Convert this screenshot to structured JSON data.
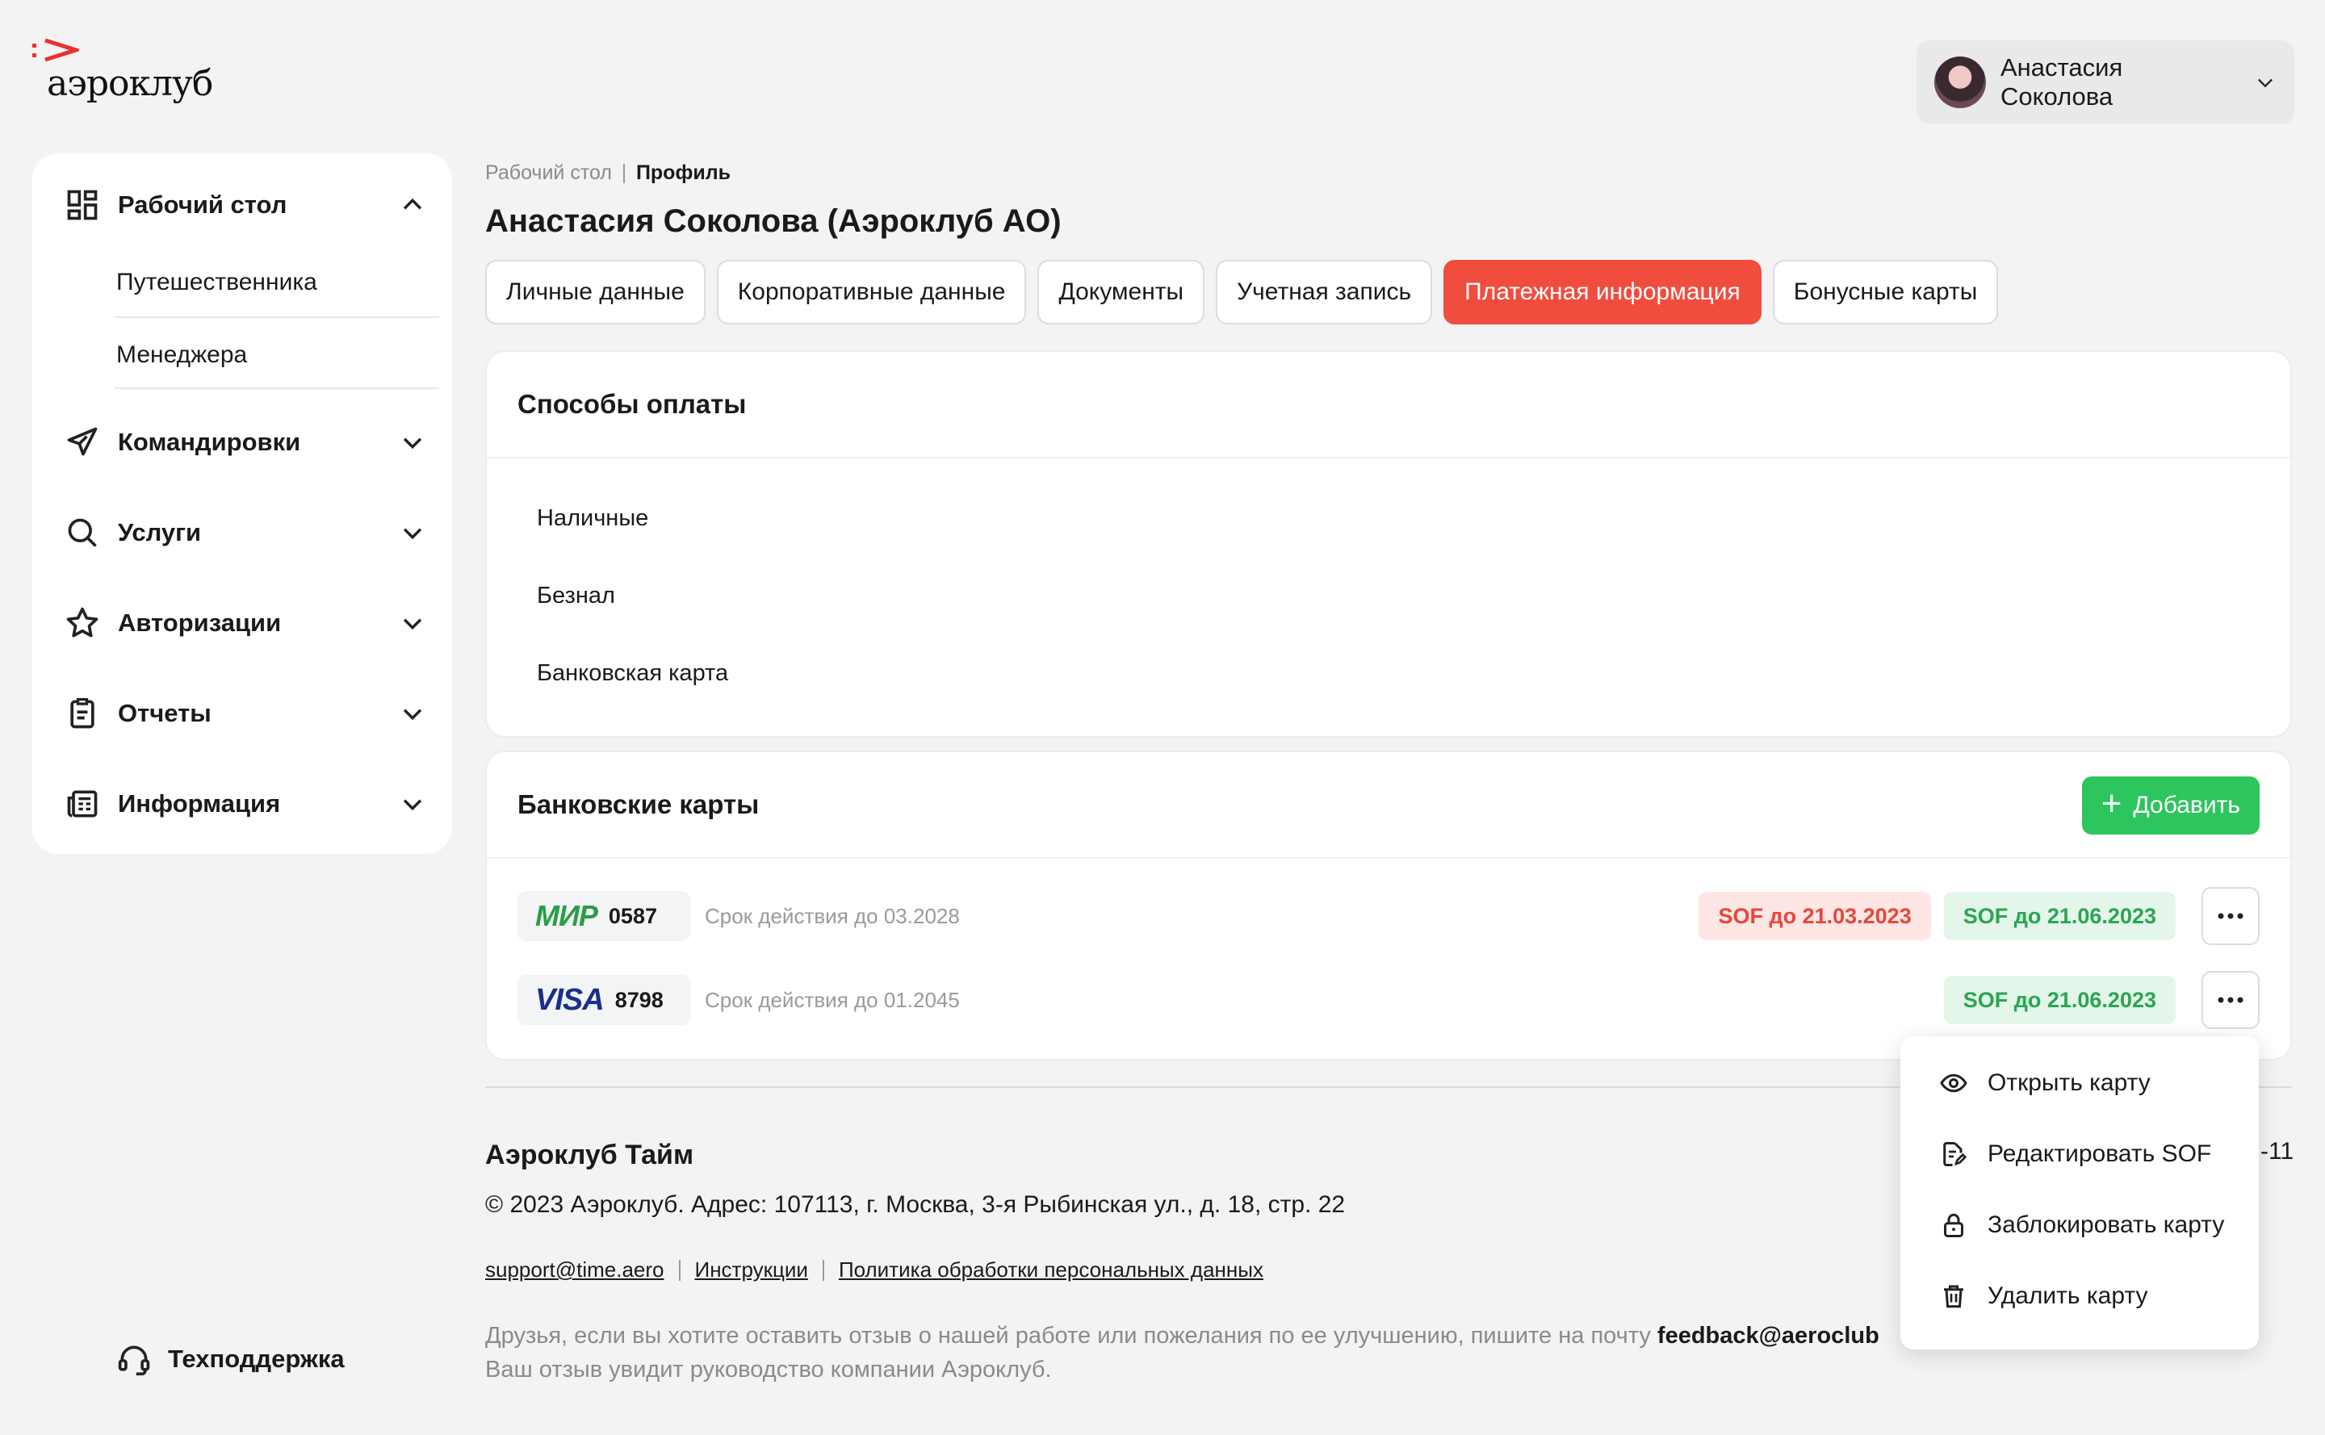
{
  "brand": {
    "name": "аэроклуб",
    "accent": "#e8322b"
  },
  "user": {
    "name": "Анастасия Соколова"
  },
  "sidebar": {
    "items": [
      {
        "label": "Рабочий стол",
        "icon": "dashboard-icon",
        "expanded": true,
        "children": [
          "Путешественника",
          "Менеджера"
        ]
      },
      {
        "label": "Командировки",
        "icon": "paper-plane-icon"
      },
      {
        "label": "Услуги",
        "icon": "search-icon"
      },
      {
        "label": "Авторизации",
        "icon": "star-icon"
      },
      {
        "label": "Отчеты",
        "icon": "clipboard-icon"
      },
      {
        "label": "Информация",
        "icon": "newspaper-icon"
      }
    ],
    "support_label": "Техподдержка"
  },
  "breadcrumb": {
    "parent": "Рабочий стол",
    "current": "Профиль"
  },
  "page_title": "Анастасия Соколова (Аэроклуб АО)",
  "tabs": [
    "Личные данные",
    "Корпоративные данные",
    "Документы",
    "Учетная запись",
    "Платежная информация",
    "Бонусные карты"
  ],
  "active_tab": "Платежная информация",
  "payment_methods": {
    "title": "Способы оплаты",
    "items": [
      "Наличные",
      "Безнал",
      "Банковская карта"
    ]
  },
  "bank_cards": {
    "title": "Банковские карты",
    "add_label": "Добавить",
    "cards": [
      {
        "brand": "МИР",
        "last4": "0587",
        "expiry": "Срок действия до 03.2028",
        "sof_red": "SOF до 21.03.2023",
        "sof_green": "SOF до 21.06.2023"
      },
      {
        "brand": "VISA",
        "last4": "8798",
        "expiry": "Срок действия до 01.2045",
        "sof_green": "SOF до 21.06.2023"
      }
    ]
  },
  "context_menu": {
    "items": [
      {
        "label": "Открыть карту",
        "icon": "eye-icon"
      },
      {
        "label": "Редактировать SOF",
        "icon": "edit-document-icon"
      },
      {
        "label": "Заблокировать карту",
        "icon": "lock-icon"
      },
      {
        "label": "Удалить карту",
        "icon": "trash-icon"
      }
    ]
  },
  "footer": {
    "title": "Аэроклуб Тайм",
    "copyright": "© 2023 Аэроклуб. Адрес: 107113, г. Москва, 3-я Рыбинская ул., д. 18, стр. 22",
    "links": [
      "support@time.aero",
      "Инструкции",
      "Политика обработки персональных данных"
    ],
    "note_1": "Друзья, если вы хотите оставить отзыв о нашей работе или пожелания по ее улучшению, пишите на почту ",
    "note_email": "feedback@aeroclub",
    "note_2": "Ваш отзыв увидит руководство компании Аэроклуб.",
    "right_fragment": "-11"
  },
  "colors": {
    "accent_red": "#f04d3f",
    "green": "#2dc55e",
    "bg": "#f3f3f3"
  }
}
